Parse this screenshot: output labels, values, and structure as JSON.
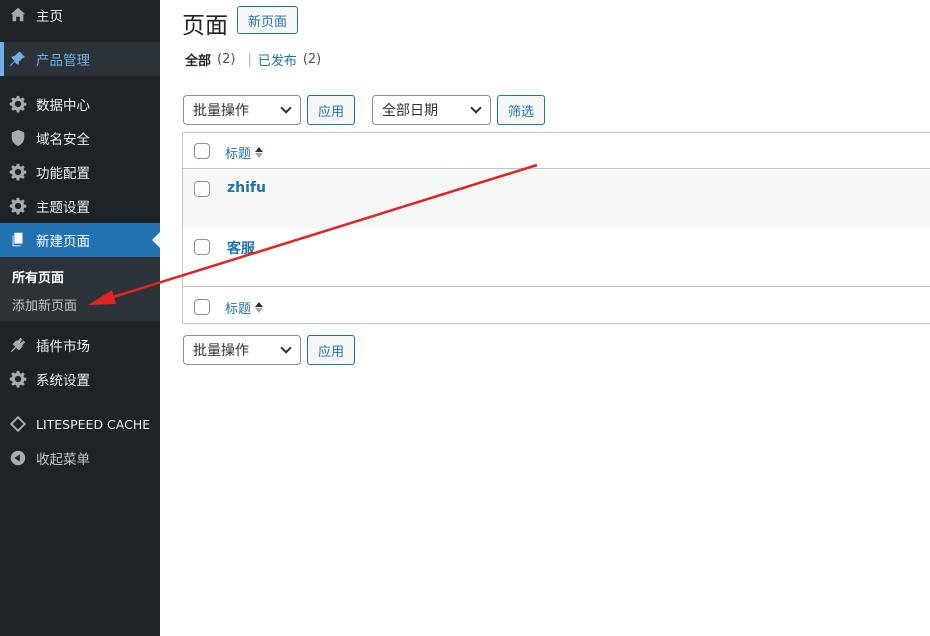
{
  "sidebar": {
    "items": [
      {
        "label": "主页",
        "icon": "home-icon"
      },
      {
        "label": "产品管理",
        "icon": "pin-icon"
      },
      {
        "label": "数据中心",
        "icon": "gear-icon"
      },
      {
        "label": "域名安全",
        "icon": "shield-icon"
      },
      {
        "label": "功能配置",
        "icon": "gear-icon"
      },
      {
        "label": "主题设置",
        "icon": "gear-icon"
      },
      {
        "label": "新建页面",
        "icon": "pages-icon"
      },
      {
        "label": "插件市场",
        "icon": "plugin-icon"
      },
      {
        "label": "系统设置",
        "icon": "gear-icon"
      },
      {
        "label": "LITESPEED CACHE",
        "icon": "litespeed-icon"
      },
      {
        "label": "收起菜单",
        "icon": "collapse-icon"
      }
    ],
    "submenu": [
      {
        "label": "所有页面"
      },
      {
        "label": "添加新页面"
      }
    ]
  },
  "header": {
    "title": "页面",
    "add_new_label": "新页面"
  },
  "filters": {
    "all_label": "全部",
    "all_count": "(2)",
    "separator": "|",
    "published_label": "已发布",
    "published_count": "(2)"
  },
  "top_actions": {
    "bulk_select": "批量操作",
    "apply_label": "应用",
    "date_select": "全部日期",
    "filter_label": "筛选"
  },
  "table": {
    "column_title": "标题",
    "rows": [
      {
        "title": "zhifu"
      },
      {
        "title": "客服"
      }
    ]
  },
  "bottom_actions": {
    "bulk_select": "批量操作",
    "apply_label": "应用"
  },
  "colors": {
    "sidebar_bg": "#1d2327",
    "accent": "#2271b1",
    "annotation_arrow": "#e02424"
  }
}
